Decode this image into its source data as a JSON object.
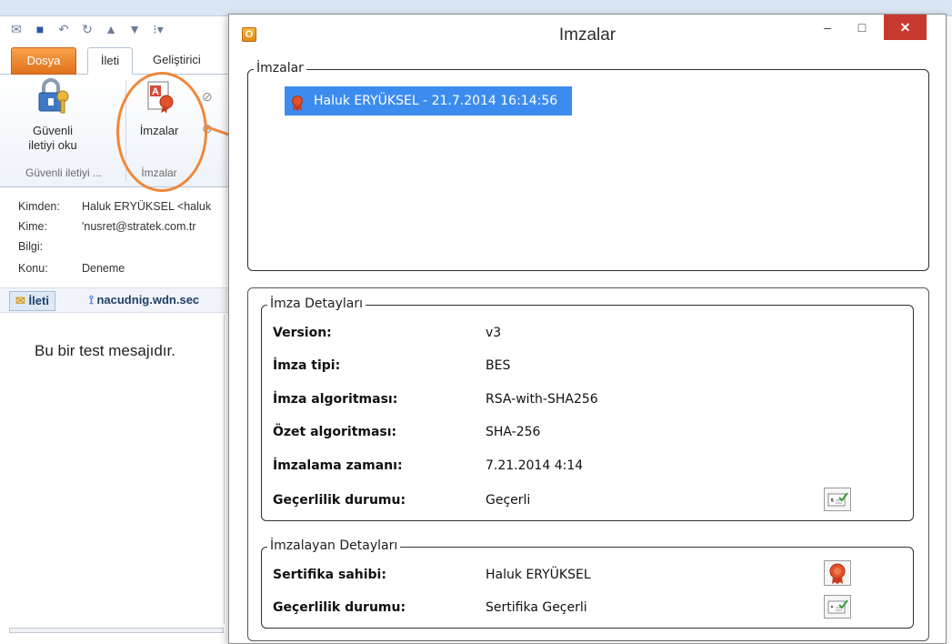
{
  "outlook": {
    "tabs": {
      "file": "Dosya",
      "message": "İleti",
      "developer": "Geliştirici"
    },
    "ribbon": {
      "secure_button": [
        "Güvenli",
        "iletiyi oku"
      ],
      "signatures_button": "İmzalar",
      "group_secure": "Güvenli iletiyi ...",
      "group_signatures": "İmzalar"
    },
    "headers": {
      "from_label": "Kimden:",
      "from_value": "Haluk ERYÜKSEL <haluk",
      "to_label": "Kime:",
      "to_value": "'nusret@stratek.com.tr",
      "cc_label": "Bilgi:",
      "cc_value": "",
      "subject_label": "Konu:",
      "subject_value": "Deneme"
    },
    "message_tabs": {
      "message": "İleti",
      "attachment": "nacudnig.wdn.sec"
    },
    "body_text": "Bu bir test mesajıdır."
  },
  "dialog": {
    "title": "Imzalar",
    "signatures_group": "İmzalar",
    "signature_item": "Haluk ERYÜKSEL - 21.7.2014 16:14:56",
    "details_group": "İmza Detayları",
    "details": [
      {
        "label": "Version:",
        "value": "v3"
      },
      {
        "label": "İmza tipi:",
        "value": "BES"
      },
      {
        "label": "İmza algoritması:",
        "value": "RSA-with-SHA256"
      },
      {
        "label": "Özet algoritması:",
        "value": "SHA-256"
      },
      {
        "label": "İmzalama zamanı:",
        "value": "7.21.2014 4:14"
      },
      {
        "label": "Geçerlilik durumu:",
        "value": "Geçerli"
      }
    ],
    "signer_group": "İmzalayan Detayları",
    "signer": [
      {
        "label": "Sertifika sahibi:",
        "value": "Haluk ERYÜKSEL"
      },
      {
        "label": "Geçerlilik durumu:",
        "value": "Sertifika Geçerli"
      }
    ]
  },
  "colors": {
    "selection": "#3c8cf0",
    "close_button": "#c7392e",
    "file_tab": "#e1721c",
    "annotation": "#f0883a"
  }
}
